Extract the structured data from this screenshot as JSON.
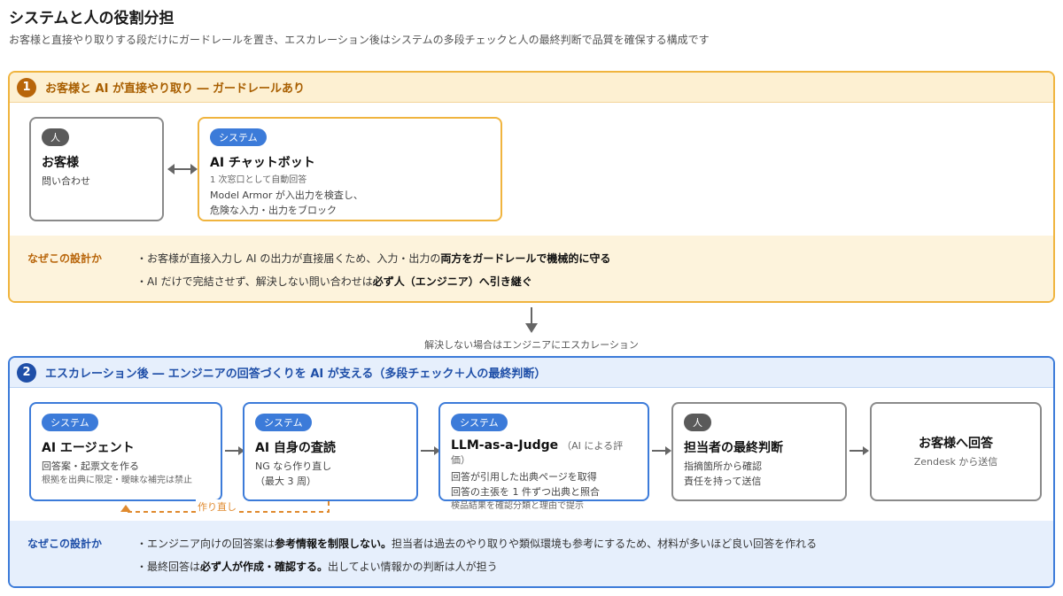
{
  "header": {
    "title": "システムと人の役割分担",
    "subtitle": "お客様と直接やり取りする段だけにガードレールを置き、エスカレーション後はシステムの多段チェックと人の最終判断で品質を確保する構成です"
  },
  "section1": {
    "number": "1",
    "title": "お客様と AI が直接やり取り ― ガードレールあり",
    "customer": {
      "badge": "人",
      "title": "お客様",
      "text": "問い合わせ"
    },
    "chatbot": {
      "badge": "システム",
      "title": "AI チャットボット",
      "line1": "1 次窓口として自動回答",
      "line2": "Model Armor が入出力を検査し、",
      "line3": "危険な入力・出力をブロック"
    },
    "why": {
      "label": "なぜこの設計か",
      "line1_pre": "・お客様が直接入力し AI の出力が直接届くため、入力・出力の",
      "line1_bold": "両方をガードレールで機械的に守る",
      "line2_pre": "・AI だけで完結させず、解決しない問い合わせは",
      "line2_bold": "必ず人（エンジニア）へ引き継ぐ"
    }
  },
  "between": {
    "label": "解決しない場合はエンジニアにエスカレーション"
  },
  "section2": {
    "number": "2",
    "title": "エスカレーション後 ― エンジニアの回答づくりを AI が支える（多段チェック＋人の最終判断）",
    "agent": {
      "badge": "システム",
      "title": "AI エージェント",
      "line1": "回答案・起票文を作る",
      "line2": "根拠を出典に限定・曖昧な補完は禁止"
    },
    "selfcheck": {
      "badge": "システム",
      "title": "AI 自身の査読",
      "line1": "NG なら作り直し",
      "line2": "（最大 3 周）"
    },
    "judge": {
      "badge": "システム",
      "title": "LLM-as-a-Judge",
      "title_note": "（AI による評価）",
      "line1": "回答が引用した出典ページを取得",
      "line2": "回答の主張を 1 件ずつ出典と照合",
      "line3": "検品結果を確認分類と理由で提示"
    },
    "owner": {
      "badge": "人",
      "title": "担当者の最終判断",
      "line1": "指摘箇所から確認",
      "line2": "責任を持って送信"
    },
    "reply": {
      "title": "お客様へ回答",
      "text": "Zendesk から送信"
    },
    "redo_label": "作り直し",
    "why": {
      "label": "なぜこの設計か",
      "line1_pre": "・エンジニア向けの回答案は",
      "line1_bold": "参考情報を制限しない。",
      "line1_post": "担当者は過去のやり取りや類似環境も参考にするため、材料が多いほど良い回答を作れる",
      "line2_pre": "・最終回答は",
      "line2_bold": "必ず人が作成・確認する。",
      "line2_post": "出してよい情報かの判断は人が担う"
    }
  },
  "colors": {
    "section1_accent": "#f0b43e",
    "section2_accent": "#3c7bd9",
    "redo_arrow": "#e08a2e"
  }
}
